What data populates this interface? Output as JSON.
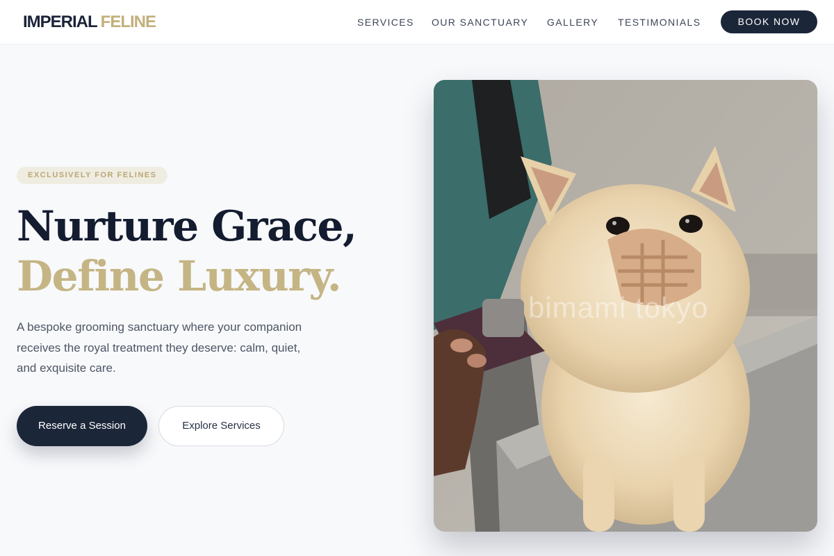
{
  "header": {
    "logo_part1": "IMPERIAL",
    "logo_part2": "FELINE",
    "nav": [
      "SERVICES",
      "OUR SANCTUARY",
      "GALLERY",
      "TESTIMONIALS"
    ],
    "cta": "BOOK NOW"
  },
  "hero": {
    "badge": "EXCLUSIVELY FOR FELINES",
    "title_line1": "Nurture Grace,",
    "title_line2": "Define Luxury.",
    "description": "A bespoke grooming sanctuary where your companion receives the royal treatment they deserve: calm, quiet, and exquisite care.",
    "primary_button": "Reserve a Session",
    "secondary_button": "Explore Services",
    "image_watermark": "bimami tokyo"
  },
  "colors": {
    "navy": "#1c2639",
    "gold": "#c5b585",
    "background": "#f8f9fb"
  }
}
